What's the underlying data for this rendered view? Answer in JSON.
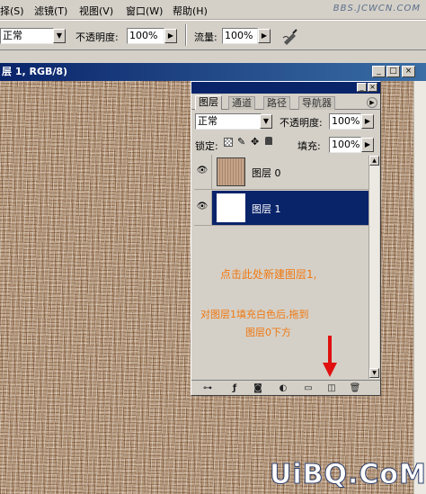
{
  "menubar": {
    "items": [
      "择(S)",
      "滤镜(T)",
      "视图(V)",
      "窗口(W)",
      "帮助(H)"
    ],
    "watermark": "BBS.JCWCN.COM"
  },
  "options": {
    "mode_value": "正常",
    "opacity_label": "不透明度:",
    "opacity_value": "100%",
    "flow_label": "流量:",
    "flow_value": "100%"
  },
  "document": {
    "title": "层 1, RGB/8)",
    "controls": [
      "_",
      "□",
      "×"
    ]
  },
  "panel": {
    "tabs": [
      "图层",
      "通道",
      "路径",
      "导航器"
    ],
    "blend_mode": "正常",
    "opacity_label": "不透明度:",
    "opacity_value": "100%",
    "lock_label": "锁定:",
    "fill_label": "填充:",
    "fill_value": "100%",
    "layers": [
      {
        "name": "图层 0",
        "selected": false
      },
      {
        "name": "图层 1",
        "selected": true
      }
    ],
    "annotations": {
      "line1": "点击此处新建图层1,",
      "line2": "对图层1填充白色后,拖到",
      "line3": "图层0下方"
    }
  },
  "watermark_bottom": "UiBQ.CoM",
  "colors": {
    "title_bar": "#0a246a",
    "selected_layer": "#0a246a",
    "annotation": "#f07810",
    "arrow": "#e01010"
  }
}
